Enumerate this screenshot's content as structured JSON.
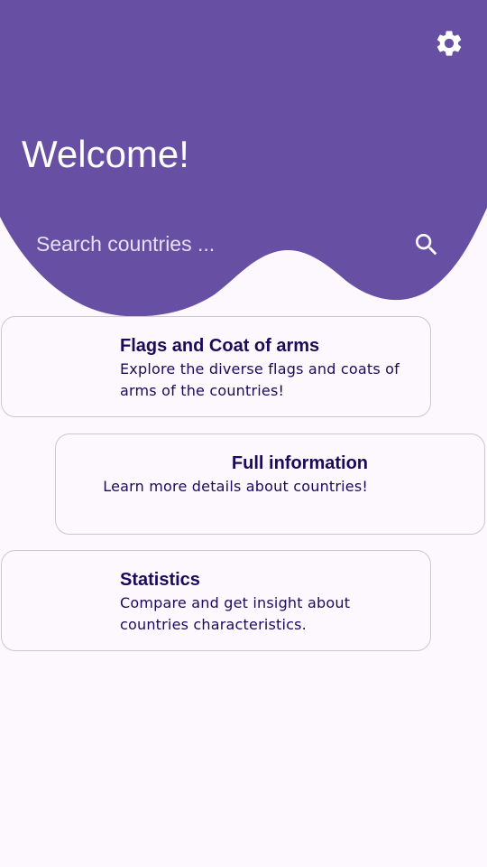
{
  "header": {
    "title": "Welcome!",
    "background_color": "#6750a4",
    "settings_icon": "gear-icon"
  },
  "search": {
    "placeholder": "Search countries ...",
    "value": "",
    "icon": "search-icon"
  },
  "cards": [
    {
      "title": "Flags and Coat of arms",
      "description": "Explore the diverse flags and coats of arms of the countries!"
    },
    {
      "title": "Full information",
      "description": "Learn more details about countries!"
    },
    {
      "title": "Statistics",
      "description": "Compare and get insight about countries characteristics."
    }
  ],
  "colors": {
    "accent": "#6750a4",
    "card_text": "#1b0a5b",
    "card_border": "#cdc6d2",
    "background": "#fdf8fd"
  }
}
